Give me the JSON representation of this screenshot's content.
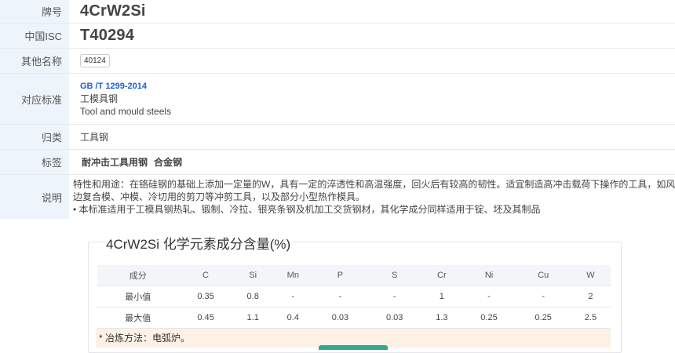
{
  "rows": {
    "grade": {
      "label": "牌号",
      "value": "4CrW2Si"
    },
    "china_isc": {
      "label": "中国ISC",
      "value": "T40294"
    },
    "other_names": {
      "label": "其他名称",
      "tags": [
        "40124"
      ]
    },
    "standard": {
      "label": "对应标准",
      "code": "GB /T 1299-2014",
      "name_cn": "工模具钢",
      "name_en": "Tool and mould steels"
    },
    "category": {
      "label": "归类",
      "value": "工具钢"
    },
    "labels": {
      "label": "标签",
      "tags": [
        "耐冲击工具用钢",
        "合金钢"
      ]
    },
    "description": {
      "label": "说明",
      "lines": [
        "特性和用途：在铬硅钢的基础上添加一定量的W，具有一定的淬透性和高温强度，回火后有较高的韧性。适宜制造高冲击载荷下操作的工具，如风动工具、冲",
        "边复合模、冲模、冷切用的剪刀等冲剪工具，以及部分小型热作模具。",
        "• 本标准适用于工模具钢热轧、锻制、冷拉、银亮条钢及机加工交货钢材，其化学成分同样适用于锭、坯及其制品"
      ]
    }
  },
  "chemistry": {
    "title": "4CrW2Si 化学元素成分含量(%)",
    "header": [
      "成分",
      "C",
      "Si",
      "Mn",
      "P",
      "S",
      "Cr",
      "Ni",
      "Cu",
      "W"
    ],
    "rows": [
      [
        "最小值",
        "0.35",
        "0.8",
        "-",
        "-",
        "-",
        "1",
        "-",
        "-",
        "2"
      ],
      [
        "最大值",
        "0.45",
        "1.1",
        "0.4",
        "0.03",
        "0.03",
        "1.3",
        "0.25",
        "0.25",
        "2.5"
      ]
    ],
    "note": "* 冶炼方法：电弧炉。"
  },
  "colors": {
    "label_bg": "#eef4fb",
    "link": "#1a5fd6",
    "note_bg": "#fdf1e6"
  }
}
